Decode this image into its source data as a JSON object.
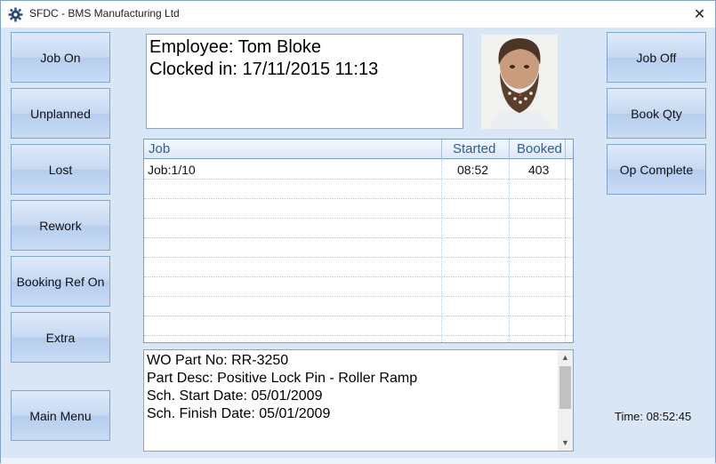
{
  "window": {
    "title": "SFDC - BMS Manufacturing Ltd"
  },
  "left_buttons": [
    "Job On",
    "Unplanned",
    "Lost",
    "Rework",
    "Booking Ref On",
    "Extra"
  ],
  "main_menu_label": "Main Menu",
  "right_buttons": [
    "Job Off",
    "Book Qty",
    "Op Complete"
  ],
  "employee": {
    "name_line": "Employee: Tom Bloke",
    "clocked_line": "Clocked in: 17/11/2015 11:13"
  },
  "jobs_table": {
    "columns": [
      "Job",
      "Started",
      "Booked"
    ],
    "rows": [
      {
        "job": "Job:1/10",
        "started": "08:52",
        "booked": "403"
      }
    ]
  },
  "work_order": {
    "lines": [
      "WO Part No: RR-3250",
      "Part Desc: Positive Lock Pin - Roller Ramp",
      "Sch. Start Date: 05/01/2009",
      "Sch. Finish Date: 05/01/2009"
    ]
  },
  "clock": {
    "label": "Time: 08:52:45"
  },
  "icons": {
    "app": "gear-icon",
    "close": "close-icon",
    "photo": "employee-photo"
  }
}
